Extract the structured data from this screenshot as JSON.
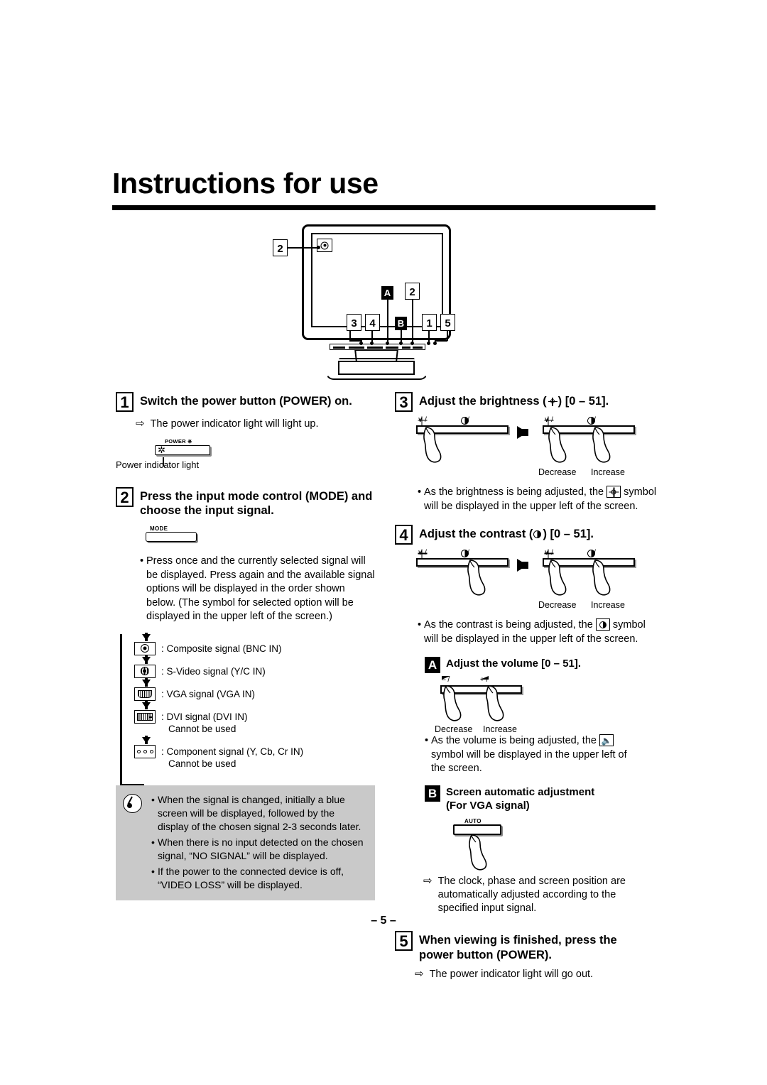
{
  "document": {
    "title": "Instructions for use",
    "page_number": "– 5 –"
  },
  "diagram": {
    "name": "monitor-front-view",
    "callouts": [
      {
        "id": "camera",
        "label": "2",
        "style": "number"
      },
      {
        "id": "ctrl-a",
        "label": "A",
        "style": "letter"
      },
      {
        "id": "ctrl-mode",
        "label": "2",
        "style": "number"
      },
      {
        "id": "ctrl-3",
        "label": "3",
        "style": "number"
      },
      {
        "id": "ctrl-4",
        "label": "4",
        "style": "number"
      },
      {
        "id": "ctrl-b",
        "label": "B",
        "style": "letter"
      },
      {
        "id": "ctrl-1",
        "label": "1",
        "style": "number"
      },
      {
        "id": "ctrl-5",
        "label": "5",
        "style": "number"
      }
    ]
  },
  "step1": {
    "num": "1",
    "title": "Switch the power button (POWER) on.",
    "result": "The power indicator light will light up.",
    "button_cap": "POWER",
    "caption": "Power indicator light"
  },
  "step2": {
    "num": "2",
    "title_line1": "Press the input mode control (MODE) and",
    "title_line2": "choose the input signal.",
    "button_cap": "MODE",
    "bullet": "Press once and the currently selected signal will be displayed. Press again and the available signal options will be displayed in the order shown below. (The symbol for selected option will be displayed in the upper left of the screen.)",
    "signals": [
      {
        "icon": "composite-icon",
        "text": ": Composite signal (BNC IN)",
        "sub": ""
      },
      {
        "icon": "svideo-icon",
        "text": ": S-Video signal (Y/C IN)",
        "sub": ""
      },
      {
        "icon": "vga-icon",
        "text": ": VGA signal (VGA IN)",
        "sub": ""
      },
      {
        "icon": "dvi-icon",
        "text": ": DVI signal (DVI IN)",
        "sub": "Cannot be used"
      },
      {
        "icon": "component-icon",
        "text": ": Component signal (Y, Cb, Cr IN)",
        "sub": "Cannot be used"
      }
    ],
    "notes": [
      "When the signal is changed, initially a blue screen will be displayed, followed by the display of the chosen signal 2-3 seconds later.",
      "When there is no input detected on the chosen signal, “NO SIGNAL” will be displayed.",
      "If the power to the connected device is off, “VIDEO LOSS” will be displayed."
    ],
    "note_bg": "#c9c9c9"
  },
  "step3": {
    "num": "3",
    "title_pre": "Adjust the brightness (",
    "title_post": ") [0 – 51].",
    "slider_label_left": "∨ /",
    "slider_label_right": "∧ /",
    "caption_decrease": "Decrease",
    "caption_increase": "Increase",
    "bullet_pre": "As the brightness is being adjusted, the",
    "bullet_post": "symbol will be displayed in the upper left of the screen."
  },
  "step4": {
    "num": "4",
    "title_pre": "Adjust the contrast (",
    "title_post": ") [0 – 51].",
    "slider_label_left": "∨ /",
    "slider_label_right": "∧ /",
    "caption_decrease": "Decrease",
    "caption_increase": "Increase",
    "bullet_pre": "As the contrast is being adjusted, the",
    "bullet_post": "symbol will be displayed in the upper left of the screen."
  },
  "sectionA": {
    "letter": "A",
    "title": "Adjust the volume [0 – 51].",
    "slider_label_left": "– /",
    "slider_label_right": "+ /",
    "caption_decrease": "Decrease",
    "caption_increase": "Increase",
    "bullet_pre": "As the volume is being adjusted, the",
    "bullet_post": "symbol will be displayed in the upper left of the screen."
  },
  "sectionB": {
    "letter": "B",
    "title_line1": "Screen automatic adjustment",
    "title_line2": "(For VGA signal)",
    "button_cap": "AUTO",
    "result": "The clock, phase and screen position are automatically adjusted according to the specified input signal."
  },
  "step5": {
    "num": "5",
    "title_line1": "When viewing is finished, press the",
    "title_line2": "power button (POWER).",
    "result": "The power indicator light will go out."
  }
}
